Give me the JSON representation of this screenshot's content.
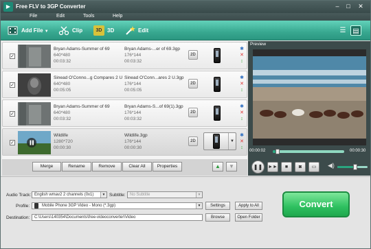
{
  "window": {
    "title": "Free FLV to 3GP Converter"
  },
  "menu": [
    "File",
    "Edit",
    "Tools",
    "Help"
  ],
  "toolbar": {
    "add_file": "Add File",
    "clip": "Clip",
    "threed": "3D",
    "edit": "Edit"
  },
  "files": [
    {
      "source_title": "Bryan Adams-Summer of 69",
      "source_res": "640*480",
      "source_duration": "00:03:32",
      "output_name": "Bryan Adams-...er of 69.3gp",
      "output_res": "176*144",
      "output_duration": "00:03:32",
      "checked": true
    },
    {
      "source_title": "Sinead O'Conno...g Compares 2 U",
      "source_res": "640*480",
      "source_duration": "00:05:05",
      "output_name": "Sinead O'Conn...ares 2 U.3gp",
      "output_res": "176*144",
      "output_duration": "00:05:05",
      "checked": true
    },
    {
      "source_title": "Bryan Adams-Summer of 69",
      "source_res": "640*480",
      "source_duration": "00:03:32",
      "output_name": "Bryan Adams-S...of 69(1).3gp",
      "output_res": "176*144",
      "output_duration": "00:03:32",
      "checked": true
    },
    {
      "source_title": "Wildlife",
      "source_res": "1280*720",
      "source_duration": "00:00:30",
      "output_name": "Wildlife.3gp",
      "output_res": "176*144",
      "output_duration": "00:00:30",
      "checked": true
    }
  ],
  "list_buttons": {
    "merge": "Merge",
    "rename": "Rename",
    "remove": "Remove",
    "clear_all": "Clear All",
    "properties": "Properties"
  },
  "preview": {
    "label": "Preview",
    "time_current": "00:00:02",
    "time_total": "00:00:30",
    "progress": 0.07,
    "volume": 0.6
  },
  "settings": {
    "audio_track_label": "Audio Track:",
    "audio_track_value": "English wmav2 2 channels (0x1)",
    "subtitle_label": "Subtitle:",
    "subtitle_value": "No Subtitle",
    "profile_label": "Profile:",
    "profile_value": "Mobile Phone 3GP Video - Mono (*.3gp)",
    "destination_label": "Destination:",
    "destination_value": "C:\\Users\\140354\\Documents\\free-videoconverter\\Video",
    "settings_btn": "Settings",
    "apply_all_btn": "Apply to All",
    "browse_btn": "Browse",
    "open_folder_btn": "Open Folder"
  },
  "convert_label": "Convert",
  "colors": {
    "toolbar": "#38a890",
    "convert": "#2ec060",
    "titlebar": "#3f5252"
  }
}
